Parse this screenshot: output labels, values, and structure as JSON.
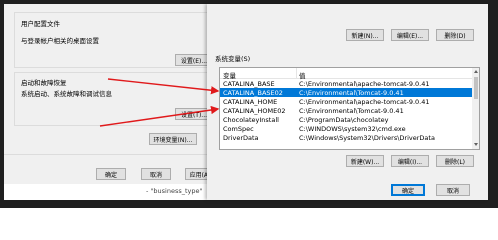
{
  "left_panel": {
    "user_profile": {
      "title": "用户配置文件",
      "desc": "与登录帐户相关的桌面设置",
      "settings_button": "设置(E)..."
    },
    "startup_recovery": {
      "title": "启动和故障恢复",
      "desc": "系统启动、系统故障和调试信息",
      "settings_button": "设置(T)..."
    },
    "env_vars_button": "环境变量(N)...",
    "ok_button": "确定",
    "cancel_button": "取消",
    "apply_button": "应用(A)"
  },
  "bottom_caption": "- \"business_type\"",
  "env_dialog": {
    "user_section_buttons": {
      "new": "新建(N)...",
      "edit": "编辑(E)...",
      "delete": "删除(D)"
    },
    "system_vars_label": "系统变量(S)",
    "headers": [
      "变量",
      "值"
    ],
    "rows": [
      {
        "name": "CATALINA_BASE",
        "value": "C:\\Environmental\\apache-tomcat-9.0.41",
        "selected": false
      },
      {
        "name": "CATALINA_BASE02",
        "value": "C:\\Environmental\\Tomcat-9.0.41",
        "selected": true
      },
      {
        "name": "CATALINA_HOME",
        "value": "C:\\Environmental\\apache-tomcat-9.0.41",
        "selected": false
      },
      {
        "name": "CATALINA_HOME02",
        "value": "C:\\Environmental\\Tomcat-9.0.41",
        "selected": false
      },
      {
        "name": "ChocolateyInstall",
        "value": "C:\\ProgramData\\chocolatey",
        "selected": false
      },
      {
        "name": "ComSpec",
        "value": "C:\\WINDOWS\\system32\\cmd.exe",
        "selected": false
      },
      {
        "name": "DriverData",
        "value": "C:\\Windows\\System32\\Drivers\\DriverData",
        "selected": false
      }
    ],
    "system_section_buttons": {
      "new": "新建(W)...",
      "edit": "编辑(I)...",
      "delete": "删除(L)"
    },
    "ok_button": "确定",
    "cancel_button": "取消"
  },
  "colors": {
    "arrow": "#e0191b",
    "selection": "#0078d7",
    "frame": "#1f1f1f"
  }
}
